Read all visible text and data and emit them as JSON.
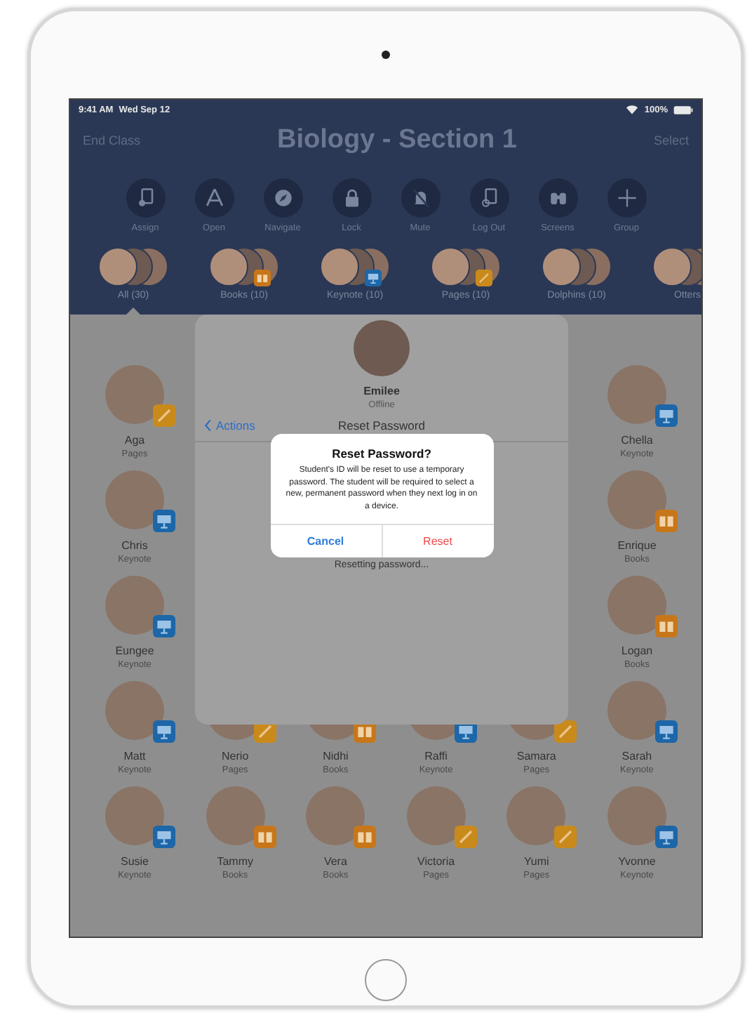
{
  "status_bar": {
    "time": "9:41 AM",
    "date": "Wed Sep 12",
    "battery": "100%"
  },
  "nav_bar": {
    "left": "End Class",
    "title": "Biology - Section 1",
    "right": "Select"
  },
  "toolbar": [
    {
      "label": "Assign"
    },
    {
      "label": "Open"
    },
    {
      "label": "Navigate"
    },
    {
      "label": "Lock"
    },
    {
      "label": "Mute"
    },
    {
      "label": "Log Out"
    },
    {
      "label": "Screens"
    },
    {
      "label": "Group"
    }
  ],
  "groups": [
    {
      "label": "All (30)",
      "selected": true,
      "kind": "plain"
    },
    {
      "label": "Books (10)",
      "selected": false,
      "kind": "books"
    },
    {
      "label": "Keynote (10)",
      "selected": false,
      "kind": "keynote"
    },
    {
      "label": "Pages (10)",
      "selected": false,
      "kind": "pages"
    },
    {
      "label": "Dolphins (10)",
      "selected": false,
      "kind": "plain"
    },
    {
      "label": "Otters",
      "selected": false,
      "kind": "plain"
    }
  ],
  "student_rows": [
    {
      "students": [
        {
          "name": "Aga",
          "app_label": "Pages",
          "kind": "pages"
        },
        {
          "name": "Chella",
          "app_label": "Keynote",
          "kind": "keynote"
        }
      ]
    },
    {
      "students": [
        {
          "name": "Chris",
          "app_label": "Keynote",
          "kind": "keynote"
        },
        {
          "name": "Enrique",
          "app_label": "Books",
          "kind": "books"
        }
      ]
    },
    {
      "students": [
        {
          "name": "Eungee",
          "app_label": "Keynote",
          "kind": "keynote"
        },
        {
          "name": "Logan",
          "app_label": "Books",
          "kind": "books"
        }
      ]
    },
    {
      "students": [
        {
          "name": "Matt",
          "app_label": "Keynote",
          "kind": "keynote"
        },
        {
          "name": "Nerio",
          "app_label": "Pages",
          "kind": "pages"
        },
        {
          "name": "Nidhi",
          "app_label": "Books",
          "kind": "books"
        },
        {
          "name": "Raffi",
          "app_label": "Keynote",
          "kind": "keynote"
        },
        {
          "name": "Samara",
          "app_label": "Pages",
          "kind": "pages"
        },
        {
          "name": "Sarah",
          "app_label": "Keynote",
          "kind": "keynote"
        }
      ]
    },
    {
      "students": [
        {
          "name": "Susie",
          "app_label": "Keynote",
          "kind": "keynote"
        },
        {
          "name": "Tammy",
          "app_label": "Books",
          "kind": "books"
        },
        {
          "name": "Vera",
          "app_label": "Books",
          "kind": "books"
        },
        {
          "name": "Victoria",
          "app_label": "Pages",
          "kind": "pages"
        },
        {
          "name": "Yumi",
          "app_label": "Pages",
          "kind": "pages"
        },
        {
          "name": "Yvonne",
          "app_label": "Keynote",
          "kind": "keynote"
        }
      ]
    }
  ],
  "popover": {
    "student_name": "Emilee",
    "student_status": "Offline",
    "back": "Actions",
    "title": "Reset Password",
    "progress": "Resetting password..."
  },
  "alert": {
    "title": "Reset Password?",
    "message": "Student's ID will be reset to use a temporary password. The student will be required to select a new, permanent password when they next log in on a device.",
    "buttons": [
      {
        "label": "Cancel",
        "kind": "cancel"
      },
      {
        "label": "Reset",
        "kind": "destructive"
      }
    ]
  }
}
